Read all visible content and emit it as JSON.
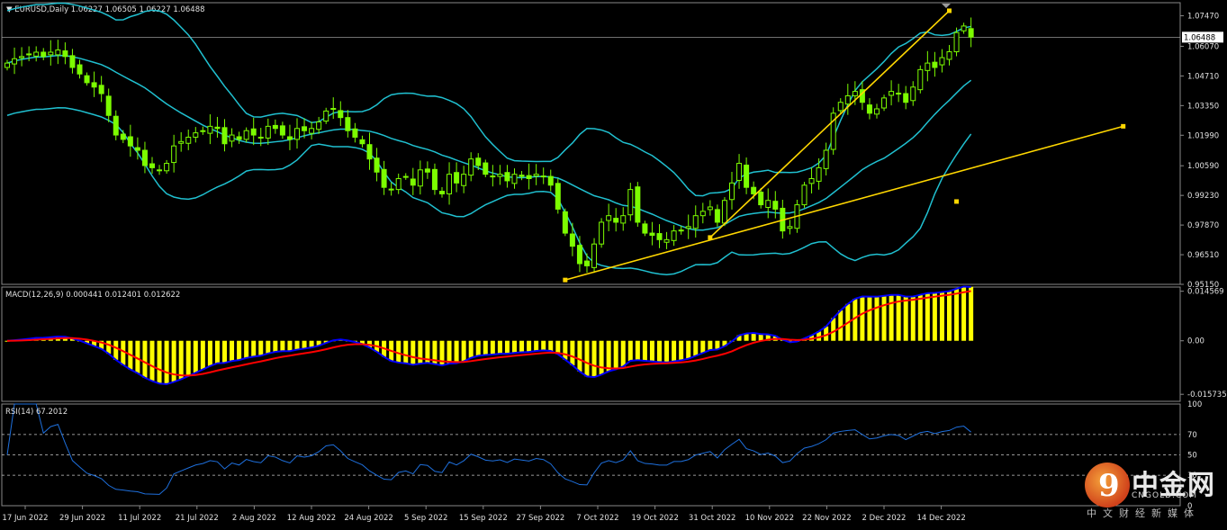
{
  "window": {
    "header_symbol": "EURUSD,Daily",
    "header_ohlc": "1.06227 1.06505 1.06227 1.06488"
  },
  "watermark": {
    "logo_glyph": "9",
    "title": "中金网",
    "domain": "CNGOLD.COM",
    "subtitle": "中文财经新媒体"
  },
  "colors": {
    "background": "#000000",
    "grid": "#888888",
    "candle": "#7cfc00",
    "bollinger": "#20c0d0",
    "trendline": "#ffd700",
    "macd_hist": "#ffff00",
    "macd_line": "#0000ff",
    "signal_line": "#ff0000",
    "rsi_line": "#1e6fdc",
    "price_line": "#b4b4b4"
  },
  "chart_data": [
    {
      "type": "candlestick",
      "name": "price",
      "header": "EURUSD,Daily 1.06227 1.06505 1.06227 1.06488",
      "last_price_label": "1.06488",
      "last_price": 1.06488,
      "ylim": [
        0.9515,
        1.0807
      ],
      "y_ticks": [
        "1.07470",
        "1.06070",
        "1.04710",
        "1.03350",
        "1.01990",
        "1.00590",
        "0.99230",
        "0.97870",
        "0.96510",
        "0.95150"
      ],
      "x_ticks": [
        "17 Jun 2022",
        "29 Jun 2022",
        "11 Jul 2022",
        "21 Jul 2022",
        "2 Aug 2022",
        "12 Aug 2022",
        "24 Aug 2022",
        "5 Sep 2022",
        "15 Sep 2022",
        "27 Sep 2022",
        "7 Oct 2022",
        "19 Oct 2022",
        "31 Oct 2022",
        "10 Nov 2022",
        "22 Nov 2022",
        "2 Dec 2022",
        "14 Dec 2022"
      ],
      "bars": 130,
      "close": [
        1.053,
        1.055,
        1.056,
        1.057,
        1.058,
        1.056,
        1.058,
        1.059,
        1.056,
        1.051,
        1.048,
        1.044,
        1.042,
        1.039,
        1.029,
        1.02,
        1.018,
        1.015,
        1.013,
        1.006,
        1.005,
        1.004,
        1.007,
        1.015,
        1.017,
        1.019,
        1.021,
        1.022,
        1.024,
        1.023,
        1.016,
        1.02,
        1.018,
        1.022,
        1.02,
        1.019,
        1.024,
        1.023,
        1.02,
        1.018,
        1.023,
        1.022,
        1.023,
        1.026,
        1.031,
        1.032,
        1.028,
        1.022,
        1.019,
        1.016,
        1.009,
        1.003,
        0.996,
        0.995,
        1.0,
        1.001,
        0.997,
        1.004,
        1.003,
        0.995,
        0.993,
        1.002,
        0.998,
        1.002,
        1.009,
        1.006,
        1.002,
        1.001,
        1.002,
        0.999,
        1.002,
        1.001,
        1.0,
        1.002,
        1.001,
        0.997,
        0.986,
        0.975,
        0.969,
        0.961,
        0.96,
        0.97,
        0.98,
        0.983,
        0.98,
        0.983,
        0.995,
        0.98,
        0.975,
        0.974,
        0.972,
        0.972,
        0.976,
        0.976,
        0.978,
        0.983,
        0.985,
        0.987,
        0.98,
        0.99,
        0.998,
        1.007,
        0.996,
        0.993,
        0.988,
        0.99,
        0.986,
        0.976,
        0.978,
        0.988,
        0.997,
        1.0,
        1.005,
        1.013,
        1.03,
        1.035,
        1.038,
        1.04,
        1.035,
        1.03,
        1.032,
        1.037,
        1.04,
        1.039,
        1.035,
        1.042,
        1.05,
        1.053,
        1.051,
        1.0555,
        1.0582,
        1.067,
        1.07,
        1.0649
      ],
      "bollinger": {
        "period": 20,
        "deviations": 2
      },
      "trendlines": [
        {
          "from": {
            "bar": 77,
            "price": 0.9535
          },
          "to": {
            "bar": 131,
            "price": 0.9895
          },
          "extend_to": {
            "bar": 154,
            "price": 1.024
          }
        },
        {
          "from": {
            "bar": 97,
            "price": 0.973
          },
          "to": {
            "bar": 130,
            "price": 1.077
          }
        }
      ]
    },
    {
      "type": "bar+line",
      "name": "macd",
      "label": "MACD(12,26,9) 0.000441 0.012401 0.012622",
      "ylim": [
        -0.0178,
        0.0158
      ],
      "y_ticks": [
        "0.014569",
        "0.00",
        "-0.015735"
      ],
      "y_tick_values": [
        0.014569,
        0.0,
        -0.015735
      ],
      "params": [
        12,
        26,
        9
      ],
      "series": [
        {
          "name": "main",
          "role": "histogram"
        },
        {
          "name": "signal",
          "role": "line"
        }
      ]
    },
    {
      "type": "line",
      "name": "rsi",
      "label": "RSI(14) 67.2012",
      "period": 14,
      "ylim": [
        0,
        100
      ],
      "y_ticks": [
        "100",
        "70",
        "50",
        "30",
        "0"
      ],
      "y_tick_values": [
        100,
        70,
        50,
        30,
        0
      ],
      "levels": [
        70,
        50,
        30
      ]
    }
  ]
}
